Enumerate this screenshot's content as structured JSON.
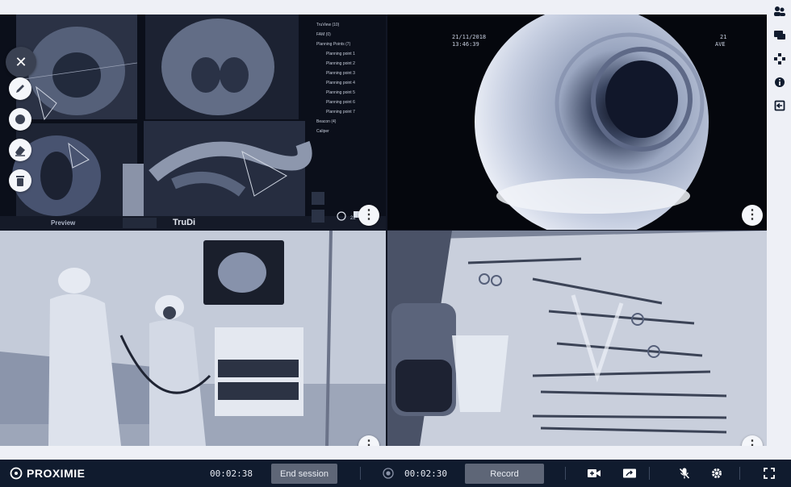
{
  "app": {
    "brand": "PROXIMIE"
  },
  "tiles": {
    "navigation": {
      "tree": [
        "TruView (10)",
        "FAM (0)",
        "Planning Points (7)",
        "Planning point 1",
        "Planning point 2",
        "Planning point 3",
        "Planning point 4",
        "Planning point 5",
        "Planning point 6",
        "Planning point 7",
        "Beacon (4)",
        "Caliper"
      ],
      "preview_label": "Preview",
      "vendor_logo": "TruDi",
      "zoom_value": "22"
    },
    "endoscope": {
      "date": "21/11/2018",
      "time": "13:46:39",
      "corner_a": "21",
      "corner_b": "AVE"
    }
  },
  "bottom_bar": {
    "session_timer": "00:02:38",
    "end_session_label": "End session",
    "record_timer": "00:02:30",
    "record_label": "Record"
  },
  "icons": {
    "close": "close-icon",
    "pen": "pen-icon",
    "circle": "circle-icon",
    "eraser": "eraser-icon",
    "trash": "trash-icon",
    "more": "more-vertical-icon",
    "participants": "participants-icon",
    "chat": "chat-icon",
    "layout": "layout-icon",
    "info": "info-icon",
    "exit": "exit-icon",
    "logo": "proximie-logo-icon",
    "record-dot": "record-dot-icon",
    "add-video": "add-video-icon",
    "screen-share": "screen-share-icon",
    "mic-off": "mic-off-icon",
    "settings": "settings-icon",
    "fullscreen": "fullscreen-icon"
  },
  "colors": {
    "bar_bg": "#101b2e",
    "accent": "#5e6677",
    "rail_bg": "#eef0f6"
  }
}
